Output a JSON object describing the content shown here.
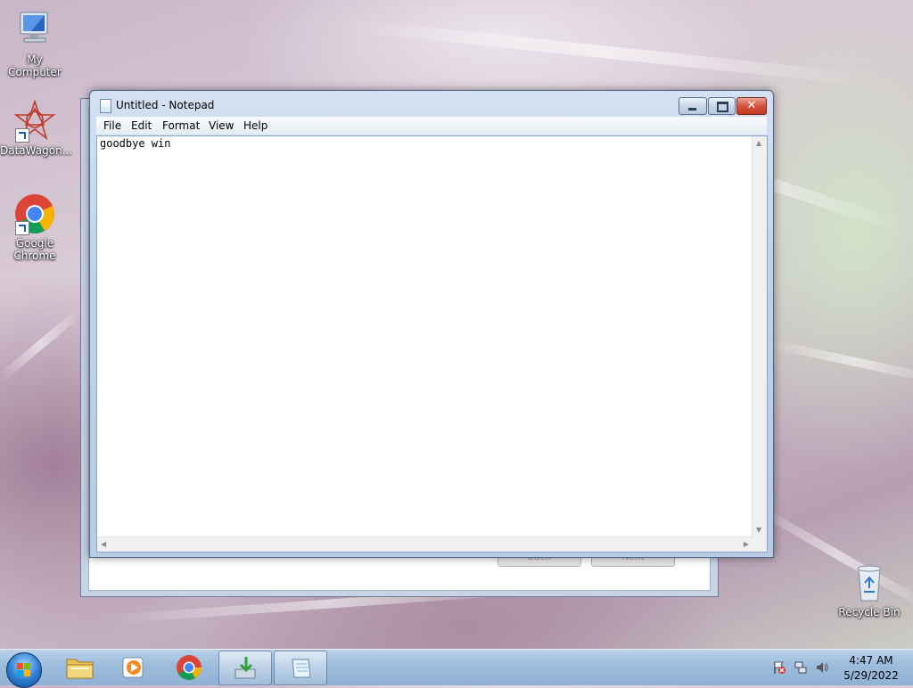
{
  "desktop": {
    "icons": [
      {
        "label": "My Computer"
      },
      {
        "label": "DataWagon..."
      },
      {
        "label": "Google Chrome"
      },
      {
        "label": "Recycle Bin"
      }
    ]
  },
  "background_dialog": {
    "back_label": "Back",
    "next_label": "Next"
  },
  "notepad": {
    "title": "Untitled - Notepad",
    "close_glyph": "✕",
    "menu": [
      "File",
      "Edit",
      "Format",
      "View",
      "Help"
    ],
    "content": "goodbye win"
  },
  "taskbar": {
    "pinned": [
      "windows-explorer",
      "media-player",
      "google-chrome",
      "installer",
      "notepad"
    ],
    "clock_time": "4:47 AM",
    "clock_date": "5/29/2022"
  },
  "colors": {
    "taskbar": "#9cbcdc",
    "close_button": "#d5533c",
    "title_bar": "#c0d1e8"
  }
}
